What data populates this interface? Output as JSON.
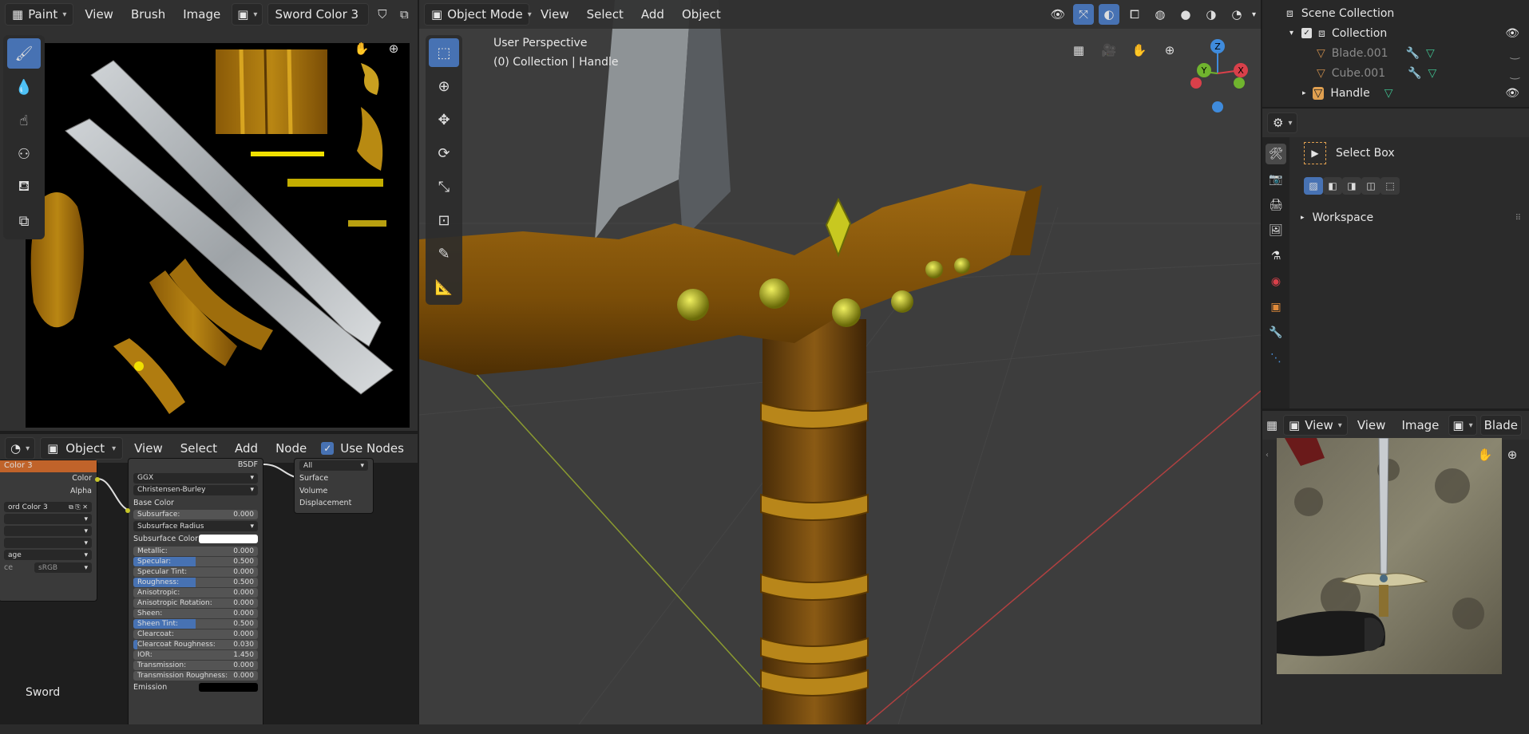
{
  "image_editor": {
    "mode": "Paint",
    "menus": [
      "View",
      "Brush",
      "Image"
    ],
    "image_name": "Sword Color 3"
  },
  "node_editor": {
    "object_type": "Object",
    "menus": [
      "View",
      "Select",
      "Add",
      "Node"
    ],
    "use_nodes_label": "Use Nodes",
    "texture_node": {
      "title": "Color 3",
      "out_color": "Color",
      "out_alpha": "Alpha",
      "image_field": "ord Color 3",
      "label_age": "age",
      "label_ce": "ce",
      "colorspace": "sRGB"
    },
    "bsdf_node": {
      "title": "BSDF",
      "distribution": "GGX",
      "subsurface_method": "Christensen-Burley",
      "base_color": "Base Color",
      "subsurface_radius": "Subsurface Radius",
      "subsurface_color": "Subsurface Color",
      "fields": [
        {
          "label": "Subsurface:",
          "value": "0.000",
          "fill": 0
        },
        {
          "label": "Metallic:",
          "value": "0.000",
          "fill": 0
        },
        {
          "label": "Specular:",
          "value": "0.500",
          "fill": 0.5
        },
        {
          "label": "Specular Tint:",
          "value": "0.000",
          "fill": 0
        },
        {
          "label": "Roughness:",
          "value": "0.500",
          "fill": 0.5
        },
        {
          "label": "Anisotropic:",
          "value": "0.000",
          "fill": 0
        },
        {
          "label": "Anisotropic Rotation:",
          "value": "0.000",
          "fill": 0
        },
        {
          "label": "Sheen:",
          "value": "0.000",
          "fill": 0
        },
        {
          "label": "Sheen Tint:",
          "value": "0.500",
          "fill": 0.5
        },
        {
          "label": "Clearcoat:",
          "value": "0.000",
          "fill": 0
        },
        {
          "label": "Clearcoat Roughness:",
          "value": "0.030",
          "fill": 0.03
        },
        {
          "label": "IOR:",
          "value": "1.450",
          "fill": 0
        },
        {
          "label": "Transmission:",
          "value": "0.000",
          "fill": 0
        },
        {
          "label": "Transmission Roughness:",
          "value": "0.000",
          "fill": 0
        }
      ],
      "emission": "Emission"
    },
    "output_node": {
      "target": "All",
      "sockets": [
        "Surface",
        "Volume",
        "Displacement"
      ]
    },
    "material_label": "Sword"
  },
  "viewport": {
    "mode": "Object Mode",
    "menus": [
      "View",
      "Select",
      "Add",
      "Object"
    ],
    "perspective": "User Perspective",
    "collection_info": "(0) Collection | Handle",
    "gizmo": {
      "x": "X",
      "y": "Y",
      "z": "Z"
    }
  },
  "outliner": {
    "scene_collection": "Scene Collection",
    "collection": "Collection",
    "objects": [
      "Blade.001",
      "Cube.001",
      "Handle"
    ]
  },
  "properties": {
    "tool_name": "Select Box",
    "workspace": "Workspace"
  },
  "image_viewer": {
    "menus": [
      "View",
      "View",
      "Image"
    ],
    "image_name": "Blade"
  },
  "colors": {
    "accent": "#4772b3",
    "socket_yellow": "#c7c729",
    "node_header_orange": "#c0632a",
    "gold": "#a8720f"
  }
}
